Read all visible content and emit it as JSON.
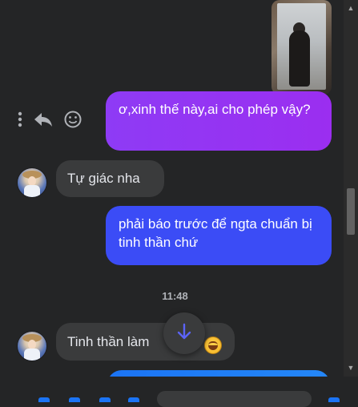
{
  "messages": {
    "out1": "ơ,xinh thế này,ai cho phép vậy?",
    "in1": "Tự giác nha",
    "out2": "phải báo trước để ngta chuẩn bị tinh thần chứ",
    "in2_text": "Tinh thần làm ",
    "in2_emoji": "grinning-sweat-emoji"
  },
  "timestamp": "11:48",
  "icons": {
    "more": "more-vertical-icon",
    "reply": "reply-icon",
    "react": "smiley-icon",
    "scroll": "arrow-down-icon"
  },
  "colors": {
    "background": "#242526",
    "outgoing_purple": "#9b2ef0",
    "outgoing_blue": "#3b4cf6",
    "incoming": "#3a3b3c",
    "scroll_arrow": "#5b63f7"
  }
}
